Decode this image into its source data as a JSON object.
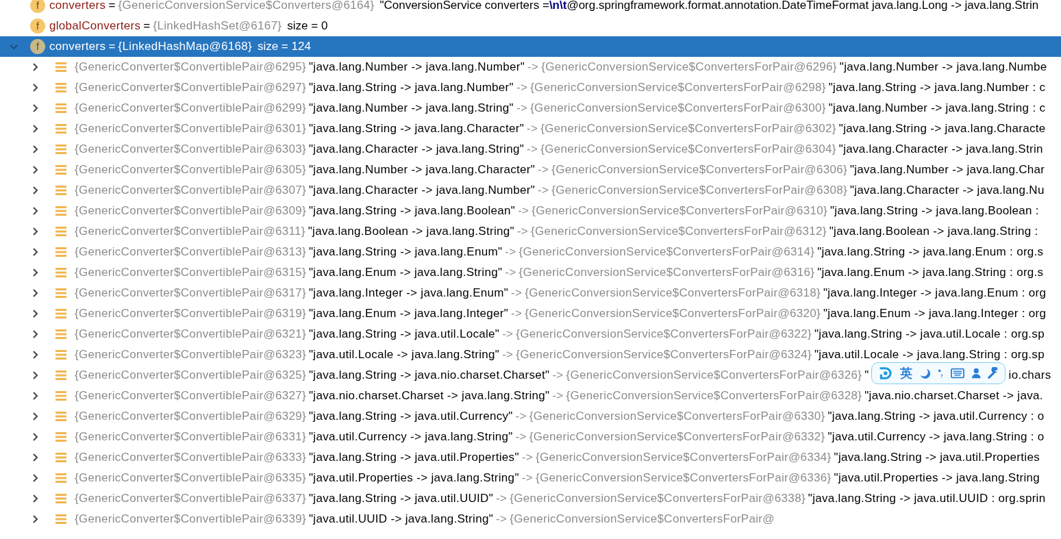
{
  "tree": {
    "badge": "f",
    "name": "converters",
    "eq": "=",
    "ref": "{GenericConversionService$Converters@6164}",
    "value": "\"ConversionService converters =**\\n\\t**@org.springframework.format.annotation.DateTimeFormat java.lang.Long -> java.lang.Strin",
    "children": [
      {
        "badge": "f",
        "name": "globalConverters",
        "eq": "=",
        "ref": "{LinkedHashSet@6167}",
        "value": "size = 0",
        "expanded": false,
        "selected": false
      },
      {
        "badge": "f",
        "name": "converters",
        "eq": "=",
        "ref": "{LinkedHashMap@6168}",
        "value": "size = 124",
        "expanded": true,
        "selected": true,
        "children": [
          {
            "key": "{GenericConverter$ConvertiblePair@6295}",
            "key_string": "\"java.lang.Number -> java.lang.Number\"",
            "arrow": "->",
            "ref": "{GenericConversionService$ConvertersForPair@6296}",
            "value_string": "\"java.lang.Number -> java.lang.Numbe",
            "expanded": false
          },
          {
            "key": "{GenericConverter$ConvertiblePair@6297}",
            "key_string": "\"java.lang.String -> java.lang.Number\"",
            "arrow": "->",
            "ref": "{GenericConversionService$ConvertersForPair@6298}",
            "value_string": "\"java.lang.String -> java.lang.Number : c",
            "expanded": false
          },
          {
            "key": "{GenericConverter$ConvertiblePair@6299}",
            "key_string": "\"java.lang.Number -> java.lang.String\"",
            "arrow": "->",
            "ref": "{GenericConversionService$ConvertersForPair@6300}",
            "value_string": "\"java.lang.Number -> java.lang.String : c",
            "expanded": false
          },
          {
            "key": "{GenericConverter$ConvertiblePair@6301}",
            "key_string": "\"java.lang.String -> java.lang.Character\"",
            "arrow": "->",
            "ref": "{GenericConversionService$ConvertersForPair@6302}",
            "value_string": "\"java.lang.String -> java.lang.Characte",
            "expanded": false
          },
          {
            "key": "{GenericConverter$ConvertiblePair@6303}",
            "key_string": "\"java.lang.Character -> java.lang.String\"",
            "arrow": "->",
            "ref": "{GenericConversionService$ConvertersForPair@6304}",
            "value_string": "\"java.lang.Character -> java.lang.Strin",
            "expanded": false
          },
          {
            "key": "{GenericConverter$ConvertiblePair@6305}",
            "key_string": "\"java.lang.Number -> java.lang.Character\"",
            "arrow": "->",
            "ref": "{GenericConversionService$ConvertersForPair@6306}",
            "value_string": "\"java.lang.Number -> java.lang.Char",
            "expanded": false
          },
          {
            "key": "{GenericConverter$ConvertiblePair@6307}",
            "key_string": "\"java.lang.Character -> java.lang.Number\"",
            "arrow": "->",
            "ref": "{GenericConversionService$ConvertersForPair@6308}",
            "value_string": "\"java.lang.Character -> java.lang.Nu",
            "expanded": false
          },
          {
            "key": "{GenericConverter$ConvertiblePair@6309}",
            "key_string": "\"java.lang.String -> java.lang.Boolean\"",
            "arrow": "->",
            "ref": "{GenericConversionService$ConvertersForPair@6310}",
            "value_string": "\"java.lang.String -> java.lang.Boolean :",
            "expanded": false
          },
          {
            "key": "{GenericConverter$ConvertiblePair@6311}",
            "key_string": "\"java.lang.Boolean -> java.lang.String\"",
            "arrow": "->",
            "ref": "{GenericConversionService$ConvertersForPair@6312}",
            "value_string": "\"java.lang.Boolean -> java.lang.String :",
            "expanded": false
          },
          {
            "key": "{GenericConverter$ConvertiblePair@6313}",
            "key_string": "\"java.lang.String -> java.lang.Enum\"",
            "arrow": "->",
            "ref": "{GenericConversionService$ConvertersForPair@6314}",
            "value_string": "\"java.lang.String -> java.lang.Enum : org.s",
            "expanded": false
          },
          {
            "key": "{GenericConverter$ConvertiblePair@6315}",
            "key_string": "\"java.lang.Enum -> java.lang.String\"",
            "arrow": "->",
            "ref": "{GenericConversionService$ConvertersForPair@6316}",
            "value_string": "\"java.lang.Enum -> java.lang.String : org.s",
            "expanded": false
          },
          {
            "key": "{GenericConverter$ConvertiblePair@6317}",
            "key_string": "\"java.lang.Integer -> java.lang.Enum\"",
            "arrow": "->",
            "ref": "{GenericConversionService$ConvertersForPair@6318}",
            "value_string": "\"java.lang.Integer -> java.lang.Enum : org",
            "expanded": false
          },
          {
            "key": "{GenericConverter$ConvertiblePair@6319}",
            "key_string": "\"java.lang.Enum -> java.lang.Integer\"",
            "arrow": "->",
            "ref": "{GenericConversionService$ConvertersForPair@6320}",
            "value_string": "\"java.lang.Enum -> java.lang.Integer : org",
            "expanded": false
          },
          {
            "key": "{GenericConverter$ConvertiblePair@6321}",
            "key_string": "\"java.lang.String -> java.util.Locale\"",
            "arrow": "->",
            "ref": "{GenericConversionService$ConvertersForPair@6322}",
            "value_string": "\"java.lang.String -> java.util.Locale : org.sp",
            "expanded": false
          },
          {
            "key": "{GenericConverter$ConvertiblePair@6323}",
            "key_string": "\"java.util.Locale -> java.lang.String\"",
            "arrow": "->",
            "ref": "{GenericConversionService$ConvertersForPair@6324}",
            "value_string": "\"java.util.Locale -> java.lang.String : org.sp",
            "expanded": false
          },
          {
            "key": "{GenericConverter$ConvertiblePair@6325}",
            "key_string": "\"java.lang.String -> java.nio.charset.Charset\"",
            "arrow": "->",
            "ref": "{GenericConversionService$ConvertersForPair@6326}",
            "value_string": "\"",
            "value_tail": "io.chars",
            "expanded": false
          },
          {
            "key": "{GenericConverter$ConvertiblePair@6327}",
            "key_string": "\"java.nio.charset.Charset -> java.lang.String\"",
            "arrow": "->",
            "ref": "{GenericConversionService$ConvertersForPair@6328}",
            "value_string": "\"java.nio.charset.Charset -> java.",
            "expanded": false
          },
          {
            "key": "{GenericConverter$ConvertiblePair@6329}",
            "key_string": "\"java.lang.String -> java.util.Currency\"",
            "arrow": "->",
            "ref": "{GenericConversionService$ConvertersForPair@6330}",
            "value_string": "\"java.lang.String -> java.util.Currency : o",
            "expanded": false
          },
          {
            "key": "{GenericConverter$ConvertiblePair@6331}",
            "key_string": "\"java.util.Currency -> java.lang.String\"",
            "arrow": "->",
            "ref": "{GenericConversionService$ConvertersForPair@6332}",
            "value_string": "\"java.util.Currency -> java.lang.String : o",
            "expanded": false
          },
          {
            "key": "{GenericConverter$ConvertiblePair@6333}",
            "key_string": "\"java.lang.String -> java.util.Properties\"",
            "arrow": "->",
            "ref": "{GenericConversionService$ConvertersForPair@6334}",
            "value_string": "\"java.lang.String -> java.util.Properties",
            "expanded": false
          },
          {
            "key": "{GenericConverter$ConvertiblePair@6335}",
            "key_string": "\"java.util.Properties -> java.lang.String\"",
            "arrow": "->",
            "ref": "{GenericConversionService$ConvertersForPair@6336}",
            "value_string": "\"java.util.Properties -> java.lang.String",
            "expanded": false
          },
          {
            "key": "{GenericConverter$ConvertiblePair@6337}",
            "key_string": "\"java.lang.String -> java.util.UUID\"",
            "arrow": "->",
            "ref": "{GenericConversionService$ConvertersForPair@6338}",
            "value_string": "\"java.lang.String -> java.util.UUID : org.sprin",
            "expanded": false
          },
          {
            "key": "{GenericConverter$ConvertiblePair@6339}",
            "key_string": "\"java.util.UUID -> java.lang.String\"",
            "arrow": "->",
            "ref": "{GenericConversionService$ConvertersForPair@",
            "expanded": false
          }
        ]
      }
    ]
  },
  "ime_toolbar": {
    "mode": "英"
  }
}
